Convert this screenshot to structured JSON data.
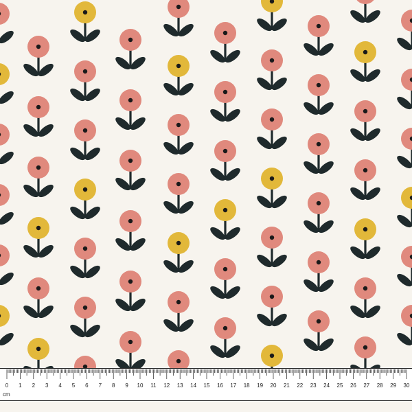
{
  "colors": {
    "background": "#f7f4ee",
    "pink_petal": "#e0897d",
    "yellow_petal": "#e2b83a",
    "stem_leaf": "#1f2a2c",
    "center_dot": "#1a1a1a",
    "ruler_bg": "#ffffff",
    "ruler_ink": "#222222"
  },
  "ruler": {
    "unit": "cm",
    "labels": [
      "0",
      "1",
      "2",
      "3",
      "4",
      "5",
      "6",
      "7",
      "8",
      "9",
      "10",
      "11",
      "12",
      "13",
      "14",
      "15",
      "16",
      "17",
      "18",
      "19",
      "20",
      "21",
      "22",
      "23",
      "24",
      "25",
      "26",
      "27",
      "28",
      "29",
      "30"
    ]
  },
  "pattern": {
    "motif": "flower-on-stem",
    "petal_colors": [
      "pink",
      "yellow"
    ]
  }
}
